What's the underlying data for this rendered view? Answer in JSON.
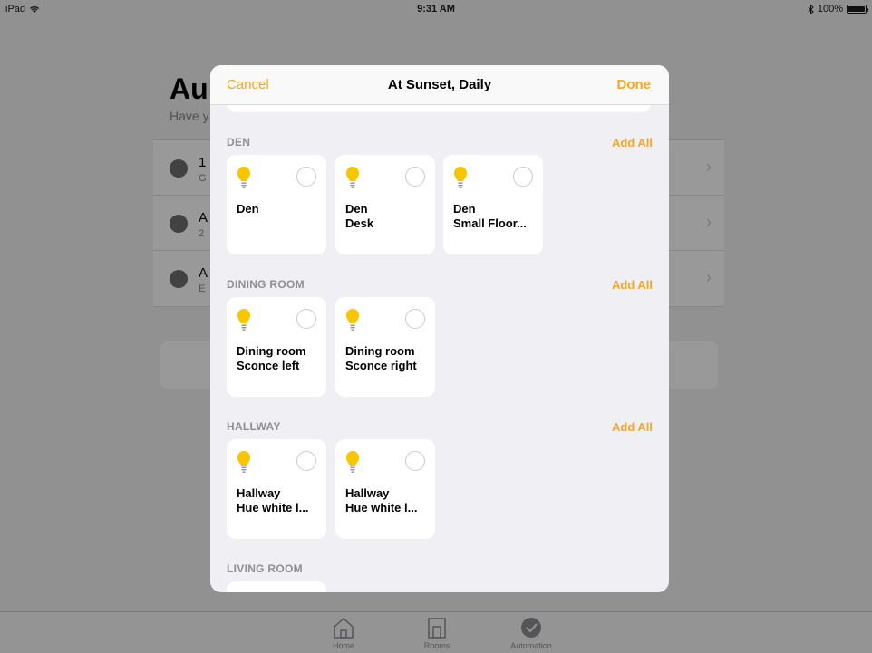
{
  "status_bar": {
    "device": "iPad",
    "time": "9:31 AM",
    "battery": "100%"
  },
  "background": {
    "title": "Au",
    "subtitle": "Have y",
    "rows": [
      {
        "title": "1",
        "sub": "G"
      },
      {
        "title": "A",
        "sub": "2"
      },
      {
        "title": "A",
        "sub": "E"
      }
    ],
    "tabs": [
      {
        "label": "Home",
        "icon": "home-icon"
      },
      {
        "label": "Rooms",
        "icon": "rooms-icon"
      },
      {
        "label": "Automation",
        "icon": "automation-icon"
      }
    ]
  },
  "modal": {
    "cancel_label": "Cancel",
    "title": "At Sunset, Daily",
    "done_label": "Done",
    "add_all_label": "Add All",
    "sections": [
      {
        "title": "DEN",
        "show_add_all": true,
        "tiles": [
          {
            "line1": "Den",
            "line2": ""
          },
          {
            "line1": "Den",
            "line2": "Desk"
          },
          {
            "line1": "Den",
            "line2": "Small Floor..."
          }
        ]
      },
      {
        "title": "DINING ROOM",
        "show_add_all": true,
        "tiles": [
          {
            "line1": "Dining room",
            "line2": "Sconce left"
          },
          {
            "line1": "Dining room",
            "line2": "Sconce right"
          }
        ]
      },
      {
        "title": "HALLWAY",
        "show_add_all": true,
        "tiles": [
          {
            "line1": "Hallway",
            "line2": "Hue white l..."
          },
          {
            "line1": "Hallway",
            "line2": "Hue white l..."
          }
        ]
      },
      {
        "title": "LIVING ROOM",
        "show_add_all": false,
        "tiles": []
      }
    ]
  },
  "colors": {
    "accent": "#f5a623",
    "bulb": "#f7c600",
    "section_title": "#8e8e93"
  }
}
